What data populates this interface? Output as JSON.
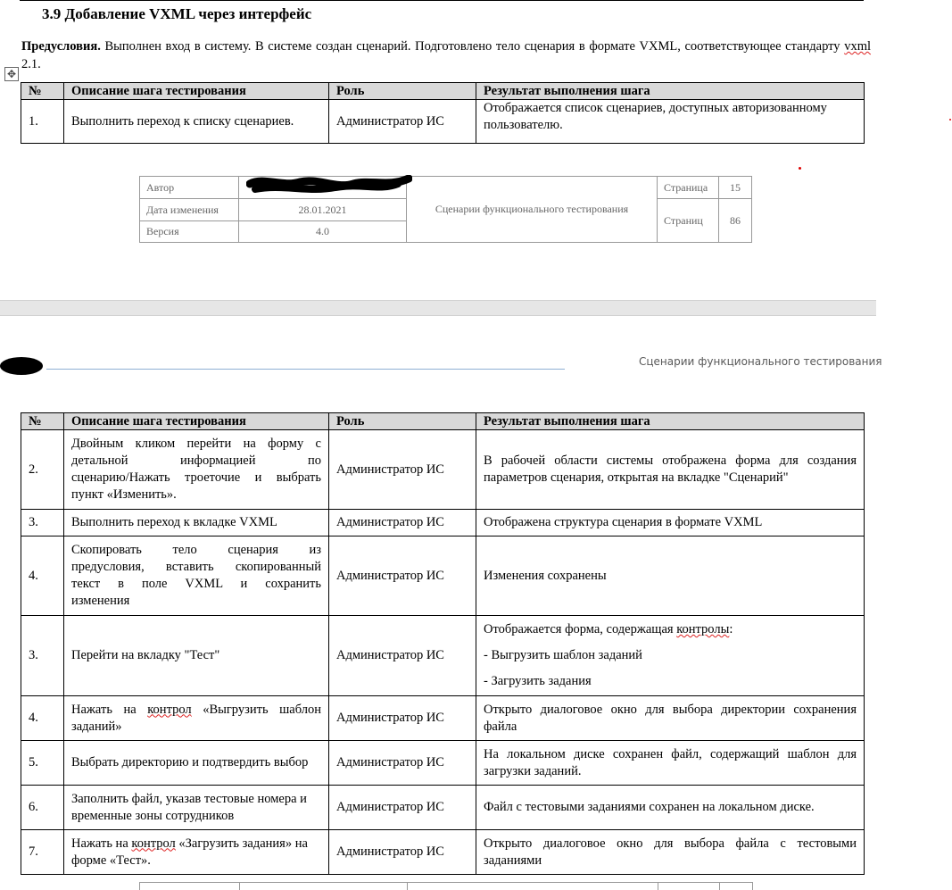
{
  "section": {
    "title": "3.9 Добавление VXML через интерфейс",
    "precondition_label": "Предусловия.",
    "precondition_text_pre": " Выполнен вход в систему. В системе создан сценарий. Подготовлено тело сценария в формате VXML, соответствующее стандарту ",
    "precondition_vxml": "vxml",
    "precondition_text_post": " 2.1."
  },
  "icons": {
    "table_handle": "move-cross-icon"
  },
  "table_headers": [
    "№",
    "Описание шага тестирования",
    "Роль",
    "Результат выполнения шага"
  ],
  "table1": {
    "rows": [
      {
        "num": "1.",
        "desc": "Выполнить переход к списку сценариев.",
        "role": "Администратор ИС",
        "result": "Отображается список сценариев, доступных авторизованному пользователю."
      }
    ]
  },
  "footer": {
    "author_label": "Автор",
    "date_label": "Дата изменения",
    "date_value": "28.01.2021",
    "version_label": "Версия",
    "version_value": "4.0",
    "doc_title": "Сценарии функционального тестирования",
    "page_label": "Страница",
    "page_value": "15",
    "pages_label": "Страниц",
    "pages_value": "86"
  },
  "header2": {
    "title": "Сценарии функционального тестирования"
  },
  "table2": {
    "rows": [
      {
        "num": "2.",
        "desc_lines": [
          "Двойным кликом перейти на форму с",
          "детальной информацией по",
          "сценарию/Нажать троеточие и выбрать",
          "пункт «Изменить»."
        ],
        "role": "Администратор ИС",
        "result": "В рабочей области системы отображена форма для создания параметров сценария, открытая на вкладке \"Сценарий\""
      },
      {
        "num": "3.",
        "desc": "Выполнить переход к вкладке VXML",
        "role": "Администратор ИС",
        "result": "Отображена структура сценария в формате VXML"
      },
      {
        "num": "4.",
        "desc_lines": [
          "Скопировать тело сценария из",
          "предусловия, вставить скопированный",
          "текст в поле VXML и сохранить",
          "изменения"
        ],
        "role": "Администратор ИС",
        "result": "Изменения сохранены"
      },
      {
        "num": "3.",
        "desc": "Перейти на вкладку \"Тест\"",
        "role": "Администратор ИС",
        "result_pre": "Отображается форма, содержащая ",
        "result_word": "контролы",
        "result_post": ":",
        "result_items": [
          "- Выгрузить шаблон заданий",
          "- Загрузить задания"
        ]
      },
      {
        "num": "4.",
        "desc_pre": "Нажать на ",
        "desc_word": "контрол",
        "desc_post": " «Выгрузить шаблон заданий»",
        "role": "Администратор ИС",
        "result": "Открыто диалоговое окно для выбора директории сохранения файла"
      },
      {
        "num": "5.",
        "desc": "Выбрать директорию и подтвердить выбор",
        "role": "Администратор ИС",
        "result": "На локальном диске сохранен файл, содержащий шаблон для загрузки заданий."
      },
      {
        "num": "6.",
        "desc": "Заполнить файл, указав тестовые номера и временные зоны сотрудников",
        "role": "Администратор ИС",
        "result": "Файл с тестовыми заданиями сохранен на локальном диске."
      },
      {
        "num": "7.",
        "desc_pre": "Нажать на ",
        "desc_word": "контрол",
        "desc_post": " «Загрузить задания» на форме «Тест».",
        "role": "Администратор ИС",
        "result": "Открыто диалоговое окно для выбора файла с тестовыми заданиями"
      }
    ]
  }
}
